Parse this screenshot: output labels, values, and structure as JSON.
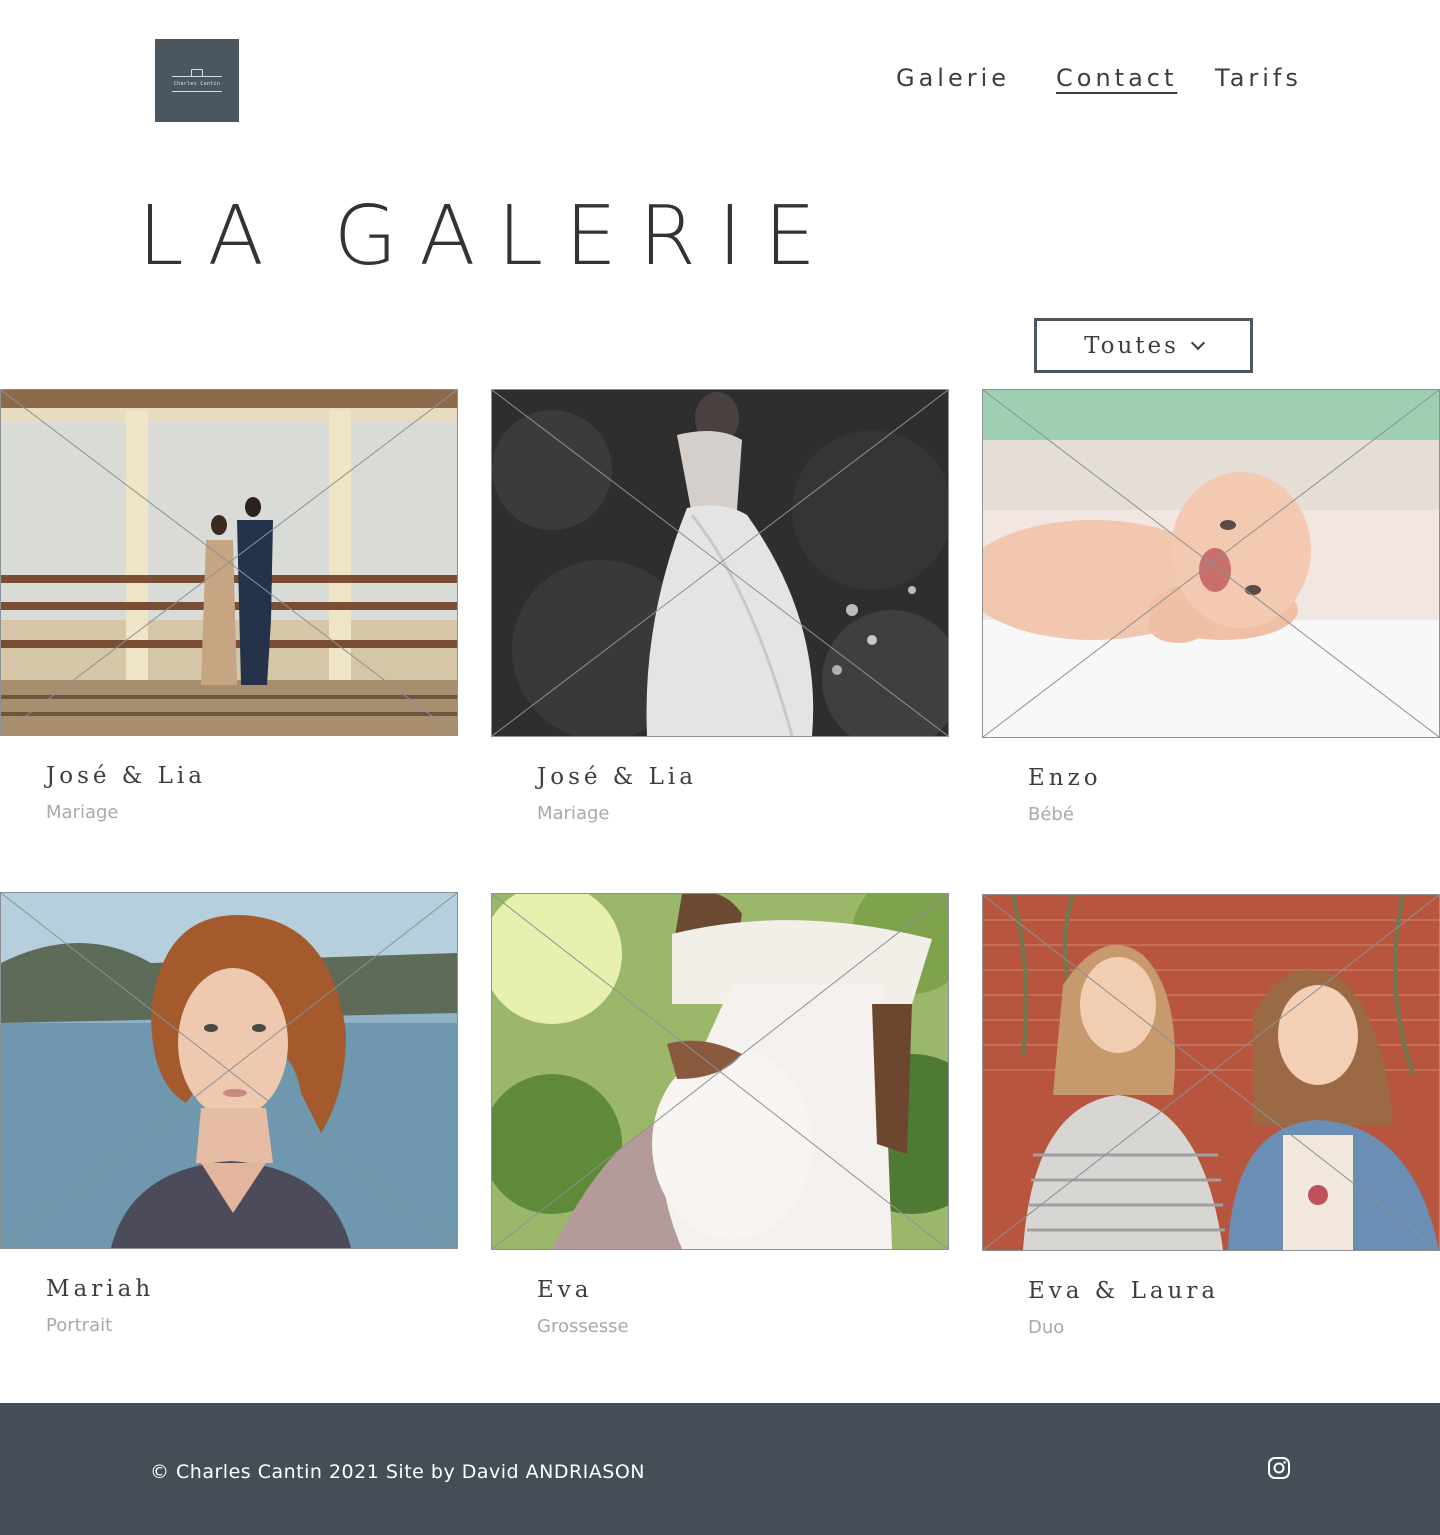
{
  "header": {
    "logo_text": "Charles Cantin",
    "nav": [
      {
        "label": "Galerie",
        "active": false
      },
      {
        "label": "Contact",
        "active": true
      },
      {
        "label": "Tarifs",
        "active": false
      }
    ]
  },
  "main": {
    "title": "LA GALERIE",
    "filter": {
      "selected": "Toutes",
      "icon": "chevron-down-icon"
    },
    "gallery": [
      {
        "name": "José & Lia",
        "category": "Mariage",
        "scene": "couple-pier"
      },
      {
        "name": "José & Lia",
        "category": "Mariage",
        "scene": "bride-forest-bw"
      },
      {
        "name": "Enzo",
        "category": "Bébé",
        "scene": "baby"
      },
      {
        "name": "Mariah",
        "category": "Portrait",
        "scene": "portrait-redhead"
      },
      {
        "name": "Eva",
        "category": "Grossesse",
        "scene": "pregnancy"
      },
      {
        "name": "Eva & Laura",
        "category": "Duo",
        "scene": "duo-brick-wall"
      }
    ]
  },
  "footer": {
    "copyright": "© Charles Cantin 2021 Site by David ANDRIASON",
    "social_icon": "instagram-icon"
  },
  "colors": {
    "brand_dark": "#4a5660",
    "footer_bg": "#454e57",
    "text": "#333333",
    "muted": "#a6aaae"
  }
}
